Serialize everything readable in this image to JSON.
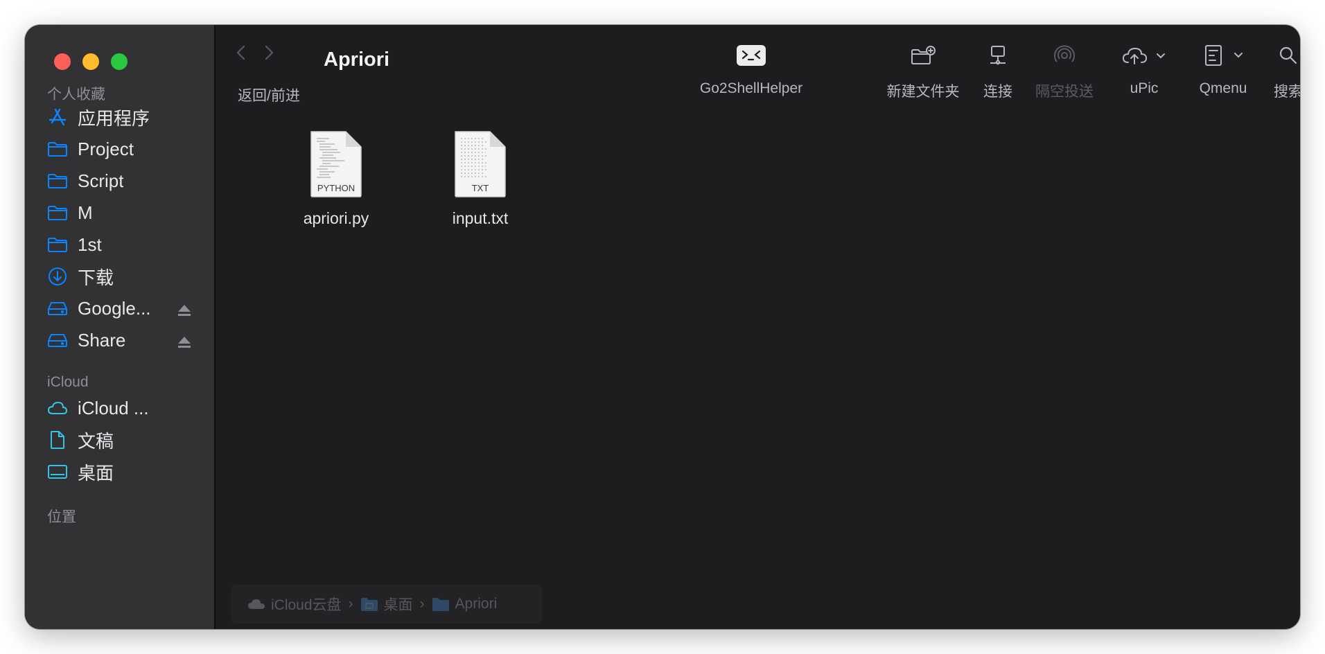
{
  "window": {
    "title": "Apriori"
  },
  "sidebar": {
    "favorites_header": "个人收藏",
    "favorites": [
      {
        "label": "应用程序",
        "icon": "applications-icon"
      },
      {
        "label": "Project",
        "icon": "folder-icon"
      },
      {
        "label": "Script",
        "icon": "folder-icon"
      },
      {
        "label": "M",
        "icon": "folder-icon"
      },
      {
        "label": "1st",
        "icon": "folder-icon"
      },
      {
        "label": "下载",
        "icon": "downloads-icon"
      },
      {
        "label": "Google...",
        "icon": "drive-icon",
        "ejectable": true
      },
      {
        "label": "Share",
        "icon": "drive-icon",
        "ejectable": true
      }
    ],
    "icloud_header": "iCloud",
    "icloud": [
      {
        "label": "iCloud ...",
        "icon": "icloud-icon"
      },
      {
        "label": "文稿",
        "icon": "document-icon"
      },
      {
        "label": "桌面",
        "icon": "desktop-icon"
      }
    ],
    "locations_header": "位置"
  },
  "toolbar": {
    "nav_label": "返回/前进",
    "buttons": [
      {
        "label": "Go2ShellHelper",
        "icon": "terminal-icon"
      },
      {
        "label": "新建文件夹",
        "icon": "new-folder-icon"
      },
      {
        "label": "连接",
        "icon": "connect-icon"
      },
      {
        "label": "隔空投送",
        "icon": "airdrop-icon",
        "disabled": true
      },
      {
        "label": "uPic",
        "icon": "upload-cloud-icon"
      },
      {
        "label": "Qmenu",
        "icon": "qmenu-icon"
      },
      {
        "label": "搜索",
        "icon": "search-icon"
      }
    ]
  },
  "files": [
    {
      "name": "apriori.py",
      "badge": "PYTHON"
    },
    {
      "name": "input.txt",
      "badge": "TXT"
    }
  ],
  "pathbar": {
    "segments": [
      "iCloud云盘",
      "桌面",
      "Apriori"
    ]
  },
  "colors": {
    "accent": "#0a84ff",
    "sidebar_bg": "#323235",
    "content_bg": "#1c1d1f",
    "close": "#fe5f57",
    "minimize": "#febc2e",
    "maximize": "#28c840"
  }
}
